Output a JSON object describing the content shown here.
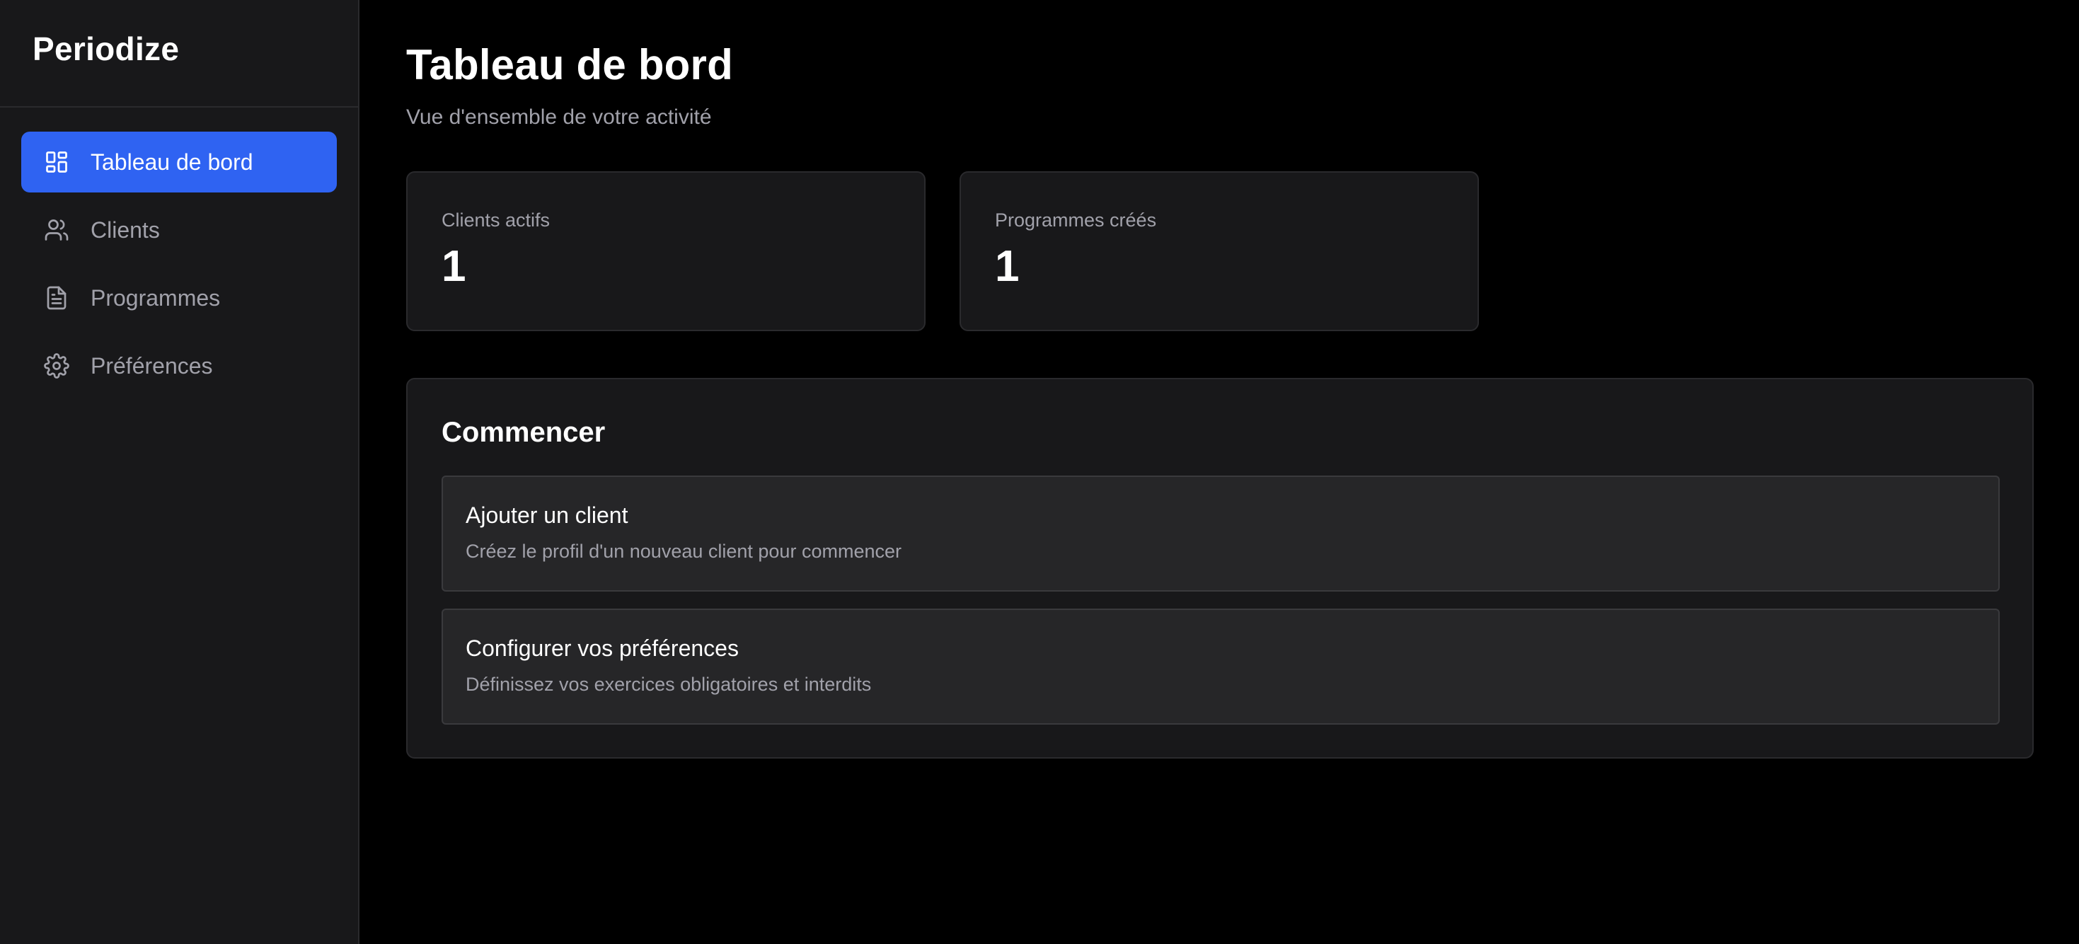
{
  "app": {
    "brand": "Periodize"
  },
  "sidebar": {
    "items": [
      {
        "label": "Tableau de bord",
        "icon": "dashboard-icon",
        "active": true
      },
      {
        "label": "Clients",
        "icon": "users-icon",
        "active": false
      },
      {
        "label": "Programmes",
        "icon": "document-icon",
        "active": false
      },
      {
        "label": "Préférences",
        "icon": "gear-icon",
        "active": false
      }
    ]
  },
  "header": {
    "title": "Tableau de bord",
    "subtitle": "Vue d'ensemble de votre activité"
  },
  "stats": [
    {
      "label": "Clients actifs",
      "value": "1"
    },
    {
      "label": "Programmes créés",
      "value": "1"
    }
  ],
  "start": {
    "title": "Commencer",
    "actions": [
      {
        "title": "Ajouter un client",
        "description": "Créez le profil d'un nouveau client pour commencer"
      },
      {
        "title": "Configurer vos préférences",
        "description": "Définissez vos exercices obligatoires et interdits"
      }
    ]
  },
  "colors": {
    "accent": "#2f63f2",
    "background": "#000000",
    "surface": "#18181a",
    "muted_text": "#a1a1aa"
  }
}
